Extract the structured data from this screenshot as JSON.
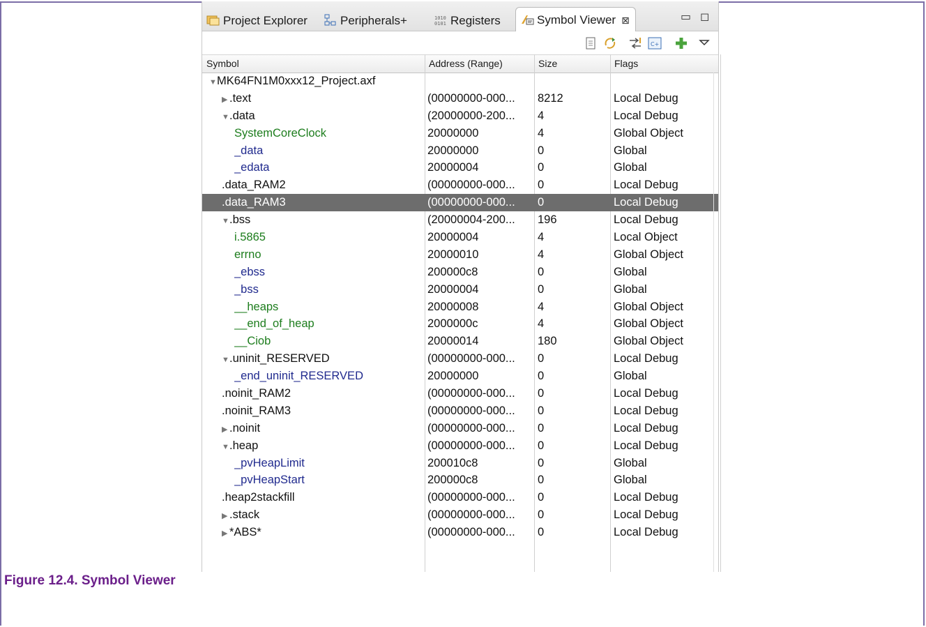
{
  "tabs": [
    {
      "label": "Project Explorer",
      "icon": "project-explorer-icon"
    },
    {
      "label": "Peripherals+",
      "icon": "peripherals-icon"
    },
    {
      "label": "Registers",
      "icon": "registers-icon"
    },
    {
      "label": "Symbol Viewer",
      "icon": "symbol-viewer-icon",
      "active": true
    }
  ],
  "columns": [
    "Symbol",
    "Address (Range)",
    "Size",
    "Flags"
  ],
  "rows": [
    {
      "level": 0,
      "expander": "▼",
      "symbol": "MK64FN1M0xxx12_Project.axf",
      "address": "",
      "size": "",
      "flags": "",
      "color": "black"
    },
    {
      "level": 1,
      "expander": "▶",
      "symbol": ".text",
      "address": "(00000000-000...",
      "size": "8212",
      "flags": "Local Debug",
      "color": "black"
    },
    {
      "level": 1,
      "expander": "▼",
      "symbol": ".data",
      "address": "(20000000-200...",
      "size": "4",
      "flags": "Local Debug",
      "color": "black"
    },
    {
      "level": 2,
      "expander": "",
      "symbol": "SystemCoreClock",
      "address": "20000000",
      "size": "4",
      "flags": "Global Object",
      "color": "green"
    },
    {
      "level": 2,
      "expander": "",
      "symbol": "_data",
      "address": "20000000",
      "size": "0",
      "flags": "Global",
      "color": "blue"
    },
    {
      "level": 2,
      "expander": "",
      "symbol": "_edata",
      "address": "20000004",
      "size": "0",
      "flags": "Global",
      "color": "blue"
    },
    {
      "level": 1,
      "expander": "",
      "symbol": ".data_RAM2",
      "address": "(00000000-000...",
      "size": "0",
      "flags": "Local Debug",
      "color": "black"
    },
    {
      "level": 1,
      "expander": "",
      "symbol": ".data_RAM3",
      "address": "(00000000-000...",
      "size": "0",
      "flags": "Local Debug",
      "color": "black",
      "selected": true
    },
    {
      "level": 1,
      "expander": "▼",
      "symbol": ".bss",
      "address": "(20000004-200...",
      "size": "196",
      "flags": "Local Debug",
      "color": "black"
    },
    {
      "level": 2,
      "expander": "",
      "symbol": "i.5865",
      "address": "20000004",
      "size": "4",
      "flags": "Local Object",
      "color": "green"
    },
    {
      "level": 2,
      "expander": "",
      "symbol": "errno",
      "address": "20000010",
      "size": "4",
      "flags": "Global Object",
      "color": "green"
    },
    {
      "level": 2,
      "expander": "",
      "symbol": "_ebss",
      "address": "200000c8",
      "size": "0",
      "flags": "Global",
      "color": "blue"
    },
    {
      "level": 2,
      "expander": "",
      "symbol": "_bss",
      "address": "20000004",
      "size": "0",
      "flags": "Global",
      "color": "blue"
    },
    {
      "level": 2,
      "expander": "",
      "symbol": "__heaps",
      "address": "20000008",
      "size": "4",
      "flags": "Global Object",
      "color": "green"
    },
    {
      "level": 2,
      "expander": "",
      "symbol": "__end_of_heap",
      "address": "2000000c",
      "size": "4",
      "flags": "Global Object",
      "color": "green"
    },
    {
      "level": 2,
      "expander": "",
      "symbol": "__Ciob",
      "address": "20000014",
      "size": "180",
      "flags": "Global Object",
      "color": "green"
    },
    {
      "level": 1,
      "expander": "▼",
      "symbol": ".uninit_RESERVED",
      "address": "(00000000-000...",
      "size": "0",
      "flags": "Local Debug",
      "color": "black"
    },
    {
      "level": 2,
      "expander": "",
      "symbol": "_end_uninit_RESERVED",
      "address": "20000000",
      "size": "0",
      "flags": "Global",
      "color": "blue"
    },
    {
      "level": 1,
      "expander": "",
      "symbol": ".noinit_RAM2",
      "address": "(00000000-000...",
      "size": "0",
      "flags": "Local Debug",
      "color": "black"
    },
    {
      "level": 1,
      "expander": "",
      "symbol": ".noinit_RAM3",
      "address": "(00000000-000...",
      "size": "0",
      "flags": "Local Debug",
      "color": "black"
    },
    {
      "level": 1,
      "expander": "▶",
      "symbol": ".noinit",
      "address": "(00000000-000...",
      "size": "0",
      "flags": "Local Debug",
      "color": "black"
    },
    {
      "level": 1,
      "expander": "▼",
      "symbol": ".heap",
      "address": "(00000000-000...",
      "size": "0",
      "flags": "Local Debug",
      "color": "black"
    },
    {
      "level": 2,
      "expander": "",
      "symbol": "_pvHeapLimit",
      "address": "200010c8",
      "size": "0",
      "flags": "Global",
      "color": "blue"
    },
    {
      "level": 2,
      "expander": "",
      "symbol": "_pvHeapStart",
      "address": "200000c8",
      "size": "0",
      "flags": "Global",
      "color": "blue"
    },
    {
      "level": 1,
      "expander": "",
      "symbol": ".heap2stackfill",
      "address": "(00000000-000...",
      "size": "0",
      "flags": "Local Debug",
      "color": "black"
    },
    {
      "level": 1,
      "expander": "▶",
      "symbol": ".stack",
      "address": "(00000000-000...",
      "size": "0",
      "flags": "Local Debug",
      "color": "black"
    },
    {
      "level": 1,
      "expander": "▶",
      "symbol": "*ABS*",
      "address": "(00000000-000...",
      "size": "0",
      "flags": "Local Debug",
      "color": "black"
    }
  ],
  "caption": "Figure 12.4. Symbol Viewer",
  "colors": {
    "green_symbol": "#1d7d1d",
    "blue_symbol": "#202a8e",
    "selected_row": "#6d6d6d",
    "caption": "#6b1f8a"
  }
}
